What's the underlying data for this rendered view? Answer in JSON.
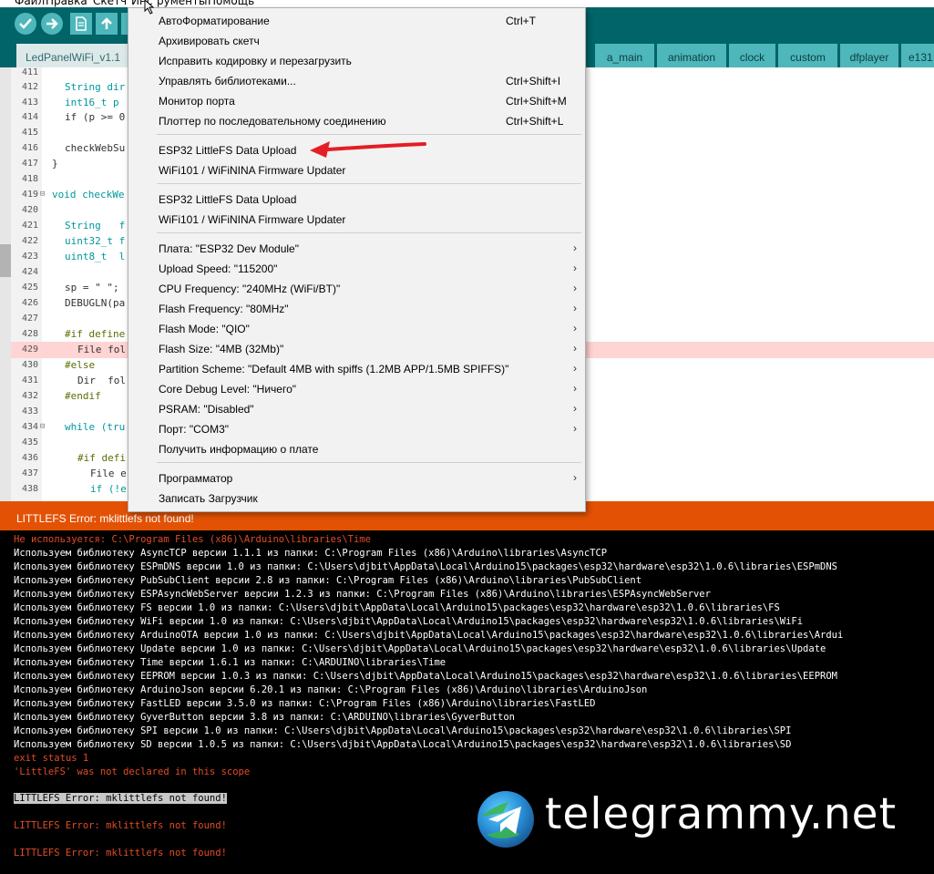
{
  "menubar": {
    "items": [
      "Файл",
      "Правка",
      "Скетч",
      "Инс",
      "рументы",
      "Помощь"
    ]
  },
  "tabs": [
    {
      "label": "LedPanelWiFi_v1.1",
      "active": true
    },
    {
      "label": "a_main"
    },
    {
      "label": "animation"
    },
    {
      "label": "clock"
    },
    {
      "label": "custom"
    },
    {
      "label": "dfplayer"
    },
    {
      "label": "e131"
    }
  ],
  "editor": {
    "lines": [
      {
        "num": "411",
        "code": ""
      },
      {
        "num": "412",
        "code": "String dir"
      },
      {
        "num": "413",
        "code": "int16_t p"
      },
      {
        "num": "414",
        "code": "if (p >= 0"
      },
      {
        "num": "415",
        "code": ""
      },
      {
        "num": "416",
        "code": "checkWebSu"
      },
      {
        "num": "417",
        "code": "}"
      },
      {
        "num": "418",
        "code": ""
      },
      {
        "num": "419",
        "code": "void checkWe"
      },
      {
        "num": "420",
        "code": ""
      },
      {
        "num": "421",
        "code": "String   f"
      },
      {
        "num": "422",
        "code": "uint32_t f"
      },
      {
        "num": "423",
        "code": "uint8_t  l"
      },
      {
        "num": "424",
        "code": ""
      },
      {
        "num": "425",
        "code": "sp = \" \";"
      },
      {
        "num": "426",
        "code": "DEBUGLN(pa"
      },
      {
        "num": "427",
        "code": ""
      },
      {
        "num": "428",
        "code": "#if define"
      },
      {
        "num": "429",
        "code": "File fol"
      },
      {
        "num": "430",
        "code": "#else"
      },
      {
        "num": "431",
        "code": "Dir  fol"
      },
      {
        "num": "432",
        "code": "#endif"
      },
      {
        "num": "433",
        "code": ""
      },
      {
        "num": "434",
        "code": "while (tru"
      },
      {
        "num": "435",
        "code": ""
      },
      {
        "num": "436",
        "code": "#if defi"
      },
      {
        "num": "437",
        "code": "File e"
      },
      {
        "num": "438",
        "code": "if (!e"
      }
    ]
  },
  "menu": {
    "items": [
      {
        "label": "АвтоФорматирование",
        "shortcut": "Ctrl+T"
      },
      {
        "label": "Архивировать скетч",
        "shortcut": ""
      },
      {
        "label": "Исправить кодировку и перезагрузить",
        "shortcut": ""
      },
      {
        "label": "Управлять библиотеками...",
        "shortcut": "Ctrl+Shift+I"
      },
      {
        "label": "Монитор порта",
        "shortcut": "Ctrl+Shift+M"
      },
      {
        "label": "Плоттер по последовательному соединению",
        "shortcut": "Ctrl+Shift+L"
      },
      {
        "label": "ESP32 LittleFS Data Upload",
        "shortcut": ""
      },
      {
        "label": "WiFi101 / WiFiNINA Firmware Updater",
        "shortcut": ""
      },
      {
        "label": "ESP32 LittleFS Data Upload",
        "shortcut": ""
      },
      {
        "label": "WiFi101 / WiFiNINA Firmware Updater",
        "shortcut": ""
      },
      {
        "label": "Плата: \"ESP32 Dev Module\"",
        "shortcut": ""
      },
      {
        "label": "Upload Speed: \"115200\"",
        "shortcut": ""
      },
      {
        "label": "CPU Frequency: \"240MHz (WiFi/BT)\"",
        "shortcut": ""
      },
      {
        "label": "Flash Frequency: \"80MHz\"",
        "shortcut": ""
      },
      {
        "label": "Flash Mode: \"QIO\"",
        "shortcut": ""
      },
      {
        "label": "Flash Size: \"4MB (32Mb)\"",
        "shortcut": ""
      },
      {
        "label": "Partition Scheme: \"Default 4MB with spiffs (1.2MB APP/1.5MB SPIFFS)\"",
        "shortcut": ""
      },
      {
        "label": "Core Debug Level: \"Ничего\"",
        "shortcut": ""
      },
      {
        "label": "PSRAM: \"Disabled\"",
        "shortcut": ""
      },
      {
        "label": "Порт: \"COM3\"",
        "shortcut": ""
      },
      {
        "label": "Получить информацию о плате",
        "shortcut": ""
      },
      {
        "label": "Программатор",
        "shortcut": ""
      },
      {
        "label": "Записать Загрузчик",
        "shortcut": ""
      }
    ]
  },
  "status": {
    "message": "LITTLEFS Error: mklittlefs not found!"
  },
  "console": {
    "lines": [
      {
        "text": "Не используется: C:\\Program Files (x86)\\Arduino\\libraries\\Time",
        "kind": "err"
      },
      {
        "text": "Используем библиотеку AsyncTCP версии 1.1.1 из папки: C:\\Program Files (x86)\\Arduino\\libraries\\AsyncTCP",
        "kind": "out"
      },
      {
        "text": "Используем библиотеку ESPmDNS версии 1.0 из папки: C:\\Users\\djbit\\AppData\\Local\\Arduino15\\packages\\esp32\\hardware\\esp32\\1.0.6\\libraries\\ESPmDNS",
        "kind": "out"
      },
      {
        "text": "Используем библиотеку PubSubClient версии 2.8 из папки: C:\\Program Files (x86)\\Arduino\\libraries\\PubSubClient",
        "kind": "out"
      },
      {
        "text": "Используем библиотеку ESPAsyncWebServer версии 1.2.3 из папки: C:\\Program Files (x86)\\Arduino\\libraries\\ESPAsyncWebServer",
        "kind": "out"
      },
      {
        "text": "Используем библиотеку FS версии 1.0 из папки: C:\\Users\\djbit\\AppData\\Local\\Arduino15\\packages\\esp32\\hardware\\esp32\\1.0.6\\libraries\\FS",
        "kind": "out"
      },
      {
        "text": "Используем библиотеку WiFi версии 1.0 из папки: C:\\Users\\djbit\\AppData\\Local\\Arduino15\\packages\\esp32\\hardware\\esp32\\1.0.6\\libraries\\WiFi",
        "kind": "out"
      },
      {
        "text": "Используем библиотеку ArduinoOTA версии 1.0 из папки: C:\\Users\\djbit\\AppData\\Local\\Arduino15\\packages\\esp32\\hardware\\esp32\\1.0.6\\libraries\\Ardui",
        "kind": "out"
      },
      {
        "text": "Используем библиотеку Update версии 1.0 из папки: C:\\Users\\djbit\\AppData\\Local\\Arduino15\\packages\\esp32\\hardware\\esp32\\1.0.6\\libraries\\Update",
        "kind": "out"
      },
      {
        "text": "Используем библиотеку Time версии 1.6.1 из папки: C:\\ARDUINO\\libraries\\Time",
        "kind": "out"
      },
      {
        "text": "Используем библиотеку EEPROM версии 1.0.3 из папки: C:\\Users\\djbit\\AppData\\Local\\Arduino15\\packages\\esp32\\hardware\\esp32\\1.0.6\\libraries\\EEPROM",
        "kind": "out"
      },
      {
        "text": "Используем библиотеку ArduinoJson версии 6.20.1 из папки: C:\\Program Files (x86)\\Arduino\\libraries\\ArduinoJson",
        "kind": "out"
      },
      {
        "text": "Используем библиотеку FastLED версии 3.5.0 из папки: C:\\Program Files (x86)\\Arduino\\libraries\\FastLED",
        "kind": "out"
      },
      {
        "text": "Используем библиотеку GyverButton версии 3.8 из папки: C:\\ARDUINO\\libraries\\GyverButton",
        "kind": "out"
      },
      {
        "text": "Используем библиотеку SPI версии 1.0 из папки: C:\\Users\\djbit\\AppData\\Local\\Arduino15\\packages\\esp32\\hardware\\esp32\\1.0.6\\libraries\\SPI",
        "kind": "out"
      },
      {
        "text": "Используем библиотеку SD версии 1.0.5 из папки: C:\\Users\\djbit\\AppData\\Local\\Arduino15\\packages\\esp32\\hardware\\esp32\\1.0.6\\libraries\\SD",
        "kind": "out"
      },
      {
        "text": "exit status 1",
        "kind": "err"
      },
      {
        "text": "'LittleFS' was not declared in this scope",
        "kind": "err"
      },
      {
        "text": "",
        "kind": "out"
      },
      {
        "text": "LITTLEFS Error: mklittlefs not found!",
        "kind": "sel"
      },
      {
        "text": "",
        "kind": "out"
      },
      {
        "text": "LITTLEFS Error: mklittlefs not found!",
        "kind": "err"
      },
      {
        "text": "",
        "kind": "out"
      },
      {
        "text": "LITTLEFS Error: mklittlefs not found!",
        "kind": "err"
      }
    ]
  },
  "watermark": {
    "text": "telegrammy.net"
  },
  "colors": {
    "toolbar": "#006468",
    "tab": "#4db7bb",
    "status": "#e35204",
    "error_text": "#e34c26"
  }
}
